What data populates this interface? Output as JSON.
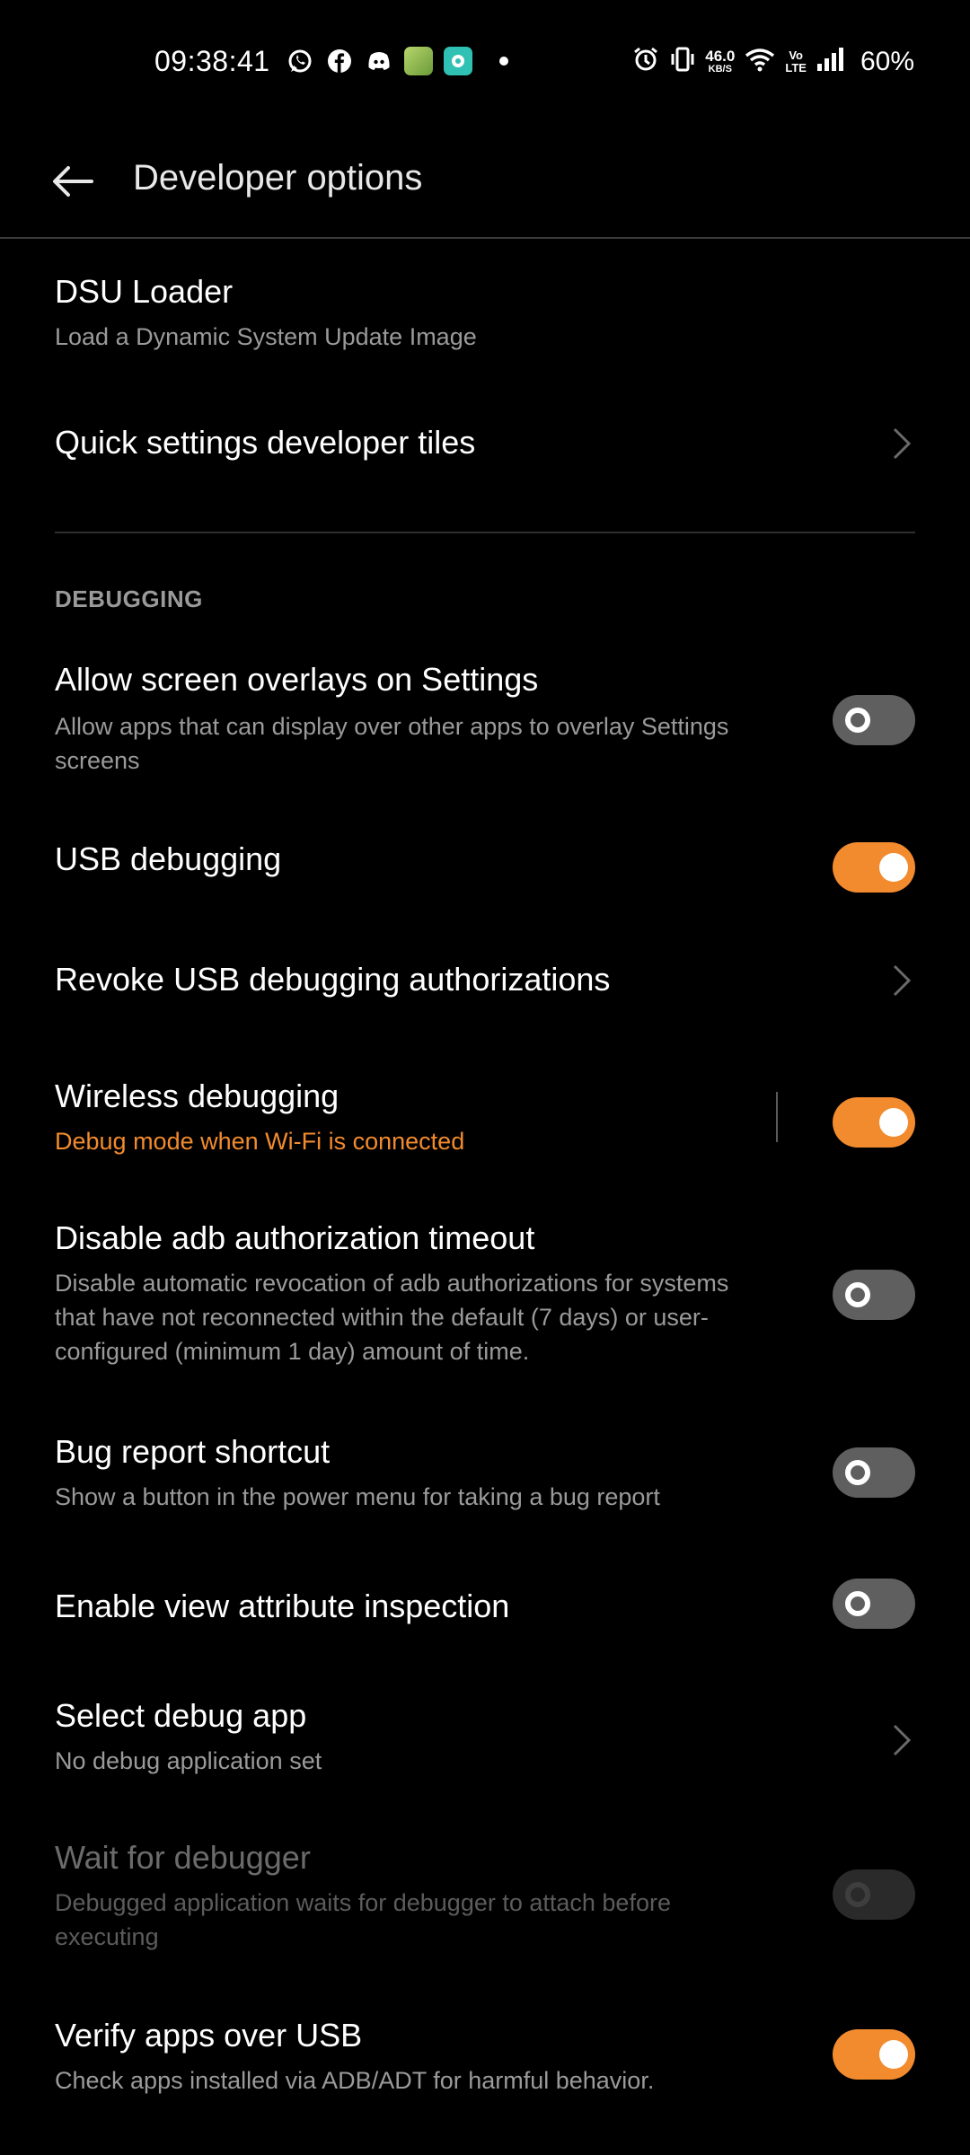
{
  "status_bar": {
    "time": "09:38:41",
    "notification_icons": [
      "whatsapp-icon",
      "facebook-icon",
      "discord-icon",
      "game-app-icon",
      "chat-app-icon"
    ],
    "net_speed_value": "46.0",
    "net_speed_unit": "KB/S",
    "volte_top": "Vo",
    "volte_bottom": "LTE",
    "battery": "60%"
  },
  "app_bar": {
    "title": "Developer options"
  },
  "colors": {
    "accent": "#f28b2e",
    "background": "#000000",
    "toggle_off": "#5f5f5f",
    "secondary_text": "#9a9a9a"
  },
  "items": {
    "dsu_loader": {
      "title": "DSU Loader",
      "subtitle": "Load a Dynamic System Update Image"
    },
    "quick_tiles": {
      "title": "Quick settings developer tiles"
    },
    "section_debugging": "DEBUGGING",
    "screen_overlays": {
      "title": "Allow screen overlays on Settings",
      "subtitle": "Allow apps that can display over other apps to overlay Settings screens",
      "enabled": false
    },
    "usb_debugging": {
      "title": "USB debugging",
      "enabled": true
    },
    "revoke_usb": {
      "title": "Revoke USB debugging authorizations"
    },
    "wireless_debugging": {
      "title": "Wireless debugging",
      "subtitle": "Debug mode when Wi-Fi is connected",
      "enabled": true
    },
    "adb_timeout": {
      "title": "Disable adb authorization timeout",
      "subtitle": "Disable automatic revocation of adb authorizations for systems that have not reconnected within the default (7 days) or user-configured (minimum 1 day) amount of time.",
      "enabled": false
    },
    "bug_report": {
      "title": "Bug report shortcut",
      "subtitle": "Show a button in the power menu for taking a bug report",
      "enabled": false
    },
    "view_attr": {
      "title": "Enable view attribute inspection",
      "enabled": false
    },
    "debug_app": {
      "title": "Select debug app",
      "subtitle": "No debug application set"
    },
    "wait_debugger": {
      "title": "Wait for debugger",
      "subtitle": "Debugged application waits for debugger to attach before executing",
      "enabled": false,
      "disabled": true
    },
    "verify_usb": {
      "title": "Verify apps over USB",
      "subtitle": "Check apps installed via ADB/ADT for harmful behavior.",
      "enabled": true
    }
  }
}
